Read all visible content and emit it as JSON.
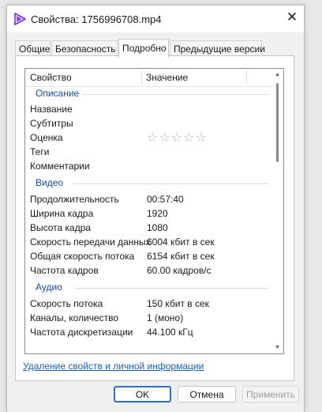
{
  "window": {
    "title": "Свойства: 1756996708.mp4"
  },
  "tabs": [
    {
      "label": "Общие"
    },
    {
      "label": "Безопасность"
    },
    {
      "label": "Подробно"
    },
    {
      "label": "Предыдущие версии"
    }
  ],
  "active_tab": "Подробно",
  "columns": {
    "property": "Свойство",
    "value": "Значение"
  },
  "groups": {
    "description": {
      "label": "Описание",
      "rows": [
        {
          "name": "Название",
          "value": ""
        },
        {
          "name": "Субтитры",
          "value": ""
        },
        {
          "name": "Оценка",
          "value": "☆☆☆☆☆",
          "rating": 0
        },
        {
          "name": "Теги",
          "value": ""
        },
        {
          "name": "Комментарии",
          "value": ""
        }
      ]
    },
    "video": {
      "label": "Видео",
      "rows": [
        {
          "name": "Продолжительность",
          "value": "00:57:40"
        },
        {
          "name": "Ширина кадра",
          "value": "1920"
        },
        {
          "name": "Высота кадра",
          "value": "1080"
        },
        {
          "name": "Скорость передачи данных",
          "value": "6004 кбит в сек"
        },
        {
          "name": "Общая скорость потока",
          "value": "6154 кбит в сек"
        },
        {
          "name": "Частота кадров",
          "value": "60.00 кадров/с"
        }
      ]
    },
    "audio": {
      "label": "Аудио",
      "rows": [
        {
          "name": "Скорость потока",
          "value": "150 кбит в сек"
        },
        {
          "name": "Каналы, количество",
          "value": "1 (моно)"
        },
        {
          "name": "Частота дискретизации",
          "value": "44.100 кГц"
        }
      ]
    }
  },
  "remove_link": "Удаление свойств и личной информации",
  "buttons": {
    "ok": "OK",
    "cancel": "Отмена",
    "apply": "Применить"
  },
  "colors": {
    "accent": "#2e6fd1",
    "group_header": "#1c4a9c",
    "link": "#1a5fb4"
  }
}
